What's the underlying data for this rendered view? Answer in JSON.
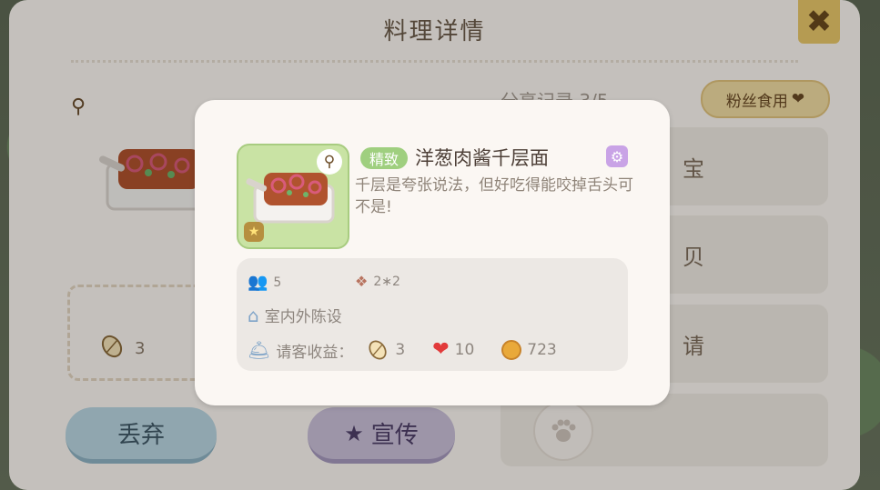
{
  "panel": {
    "title": "料理详情",
    "share_label": "分享记录 3/5",
    "fans_button": "粉丝食用",
    "side_buttons": [
      "宝",
      "贝",
      "请"
    ],
    "seed_count": "3",
    "discard_button": "丢弃",
    "promote_button": "宣传"
  },
  "popup": {
    "quality": "精致",
    "dish_name": "洋葱肉酱千层面",
    "description": "千层是夸张说法，但好吃得能咬掉舌头可不是!",
    "people": "5",
    "size": "2∗2",
    "placement": "室内外陈设",
    "income_label": "请客收益：",
    "income_seeds": "3",
    "income_hearts": "10",
    "income_coins": "723"
  },
  "colors": {
    "badge_green": "#9fcf7f",
    "heart_red": "#e23a3a",
    "coin_gold": "#e9a93a",
    "close_yellow": "#e8c769"
  },
  "icons": [
    "close-icon",
    "search-icon",
    "settings-icon",
    "people-icon",
    "tiles-icon",
    "house-icon",
    "bell-icon",
    "seed-icon",
    "heart-icon",
    "coin-icon",
    "paw-icon",
    "star-icon"
  ]
}
